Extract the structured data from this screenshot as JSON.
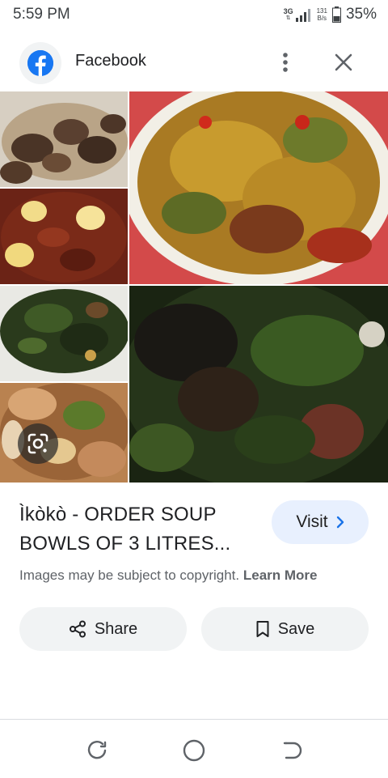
{
  "status_bar": {
    "time": "5:59 PM",
    "network": "3G",
    "speed_value": "131",
    "speed_unit": "B/s",
    "battery": "35%"
  },
  "header": {
    "site_name": "Facebook",
    "icons": {
      "site": "facebook-icon",
      "more": "more-vert-icon",
      "close": "close-icon"
    }
  },
  "image": {
    "lens_icon": "google-lens-icon"
  },
  "result": {
    "title": "Ìkòkò - ORDER SOUP BOWLS OF 3 LITRES...",
    "visit_label": "Visit",
    "copyright_text": "Images may be subject to copyright.",
    "learn_more": "Learn More"
  },
  "actions": {
    "share_label": "Share",
    "save_label": "Save"
  },
  "colors": {
    "facebook_blue": "#1877f2",
    "visit_bg": "#e8f0fe",
    "pill_bg": "#f1f3f4",
    "link_blue": "#1a73e8"
  }
}
